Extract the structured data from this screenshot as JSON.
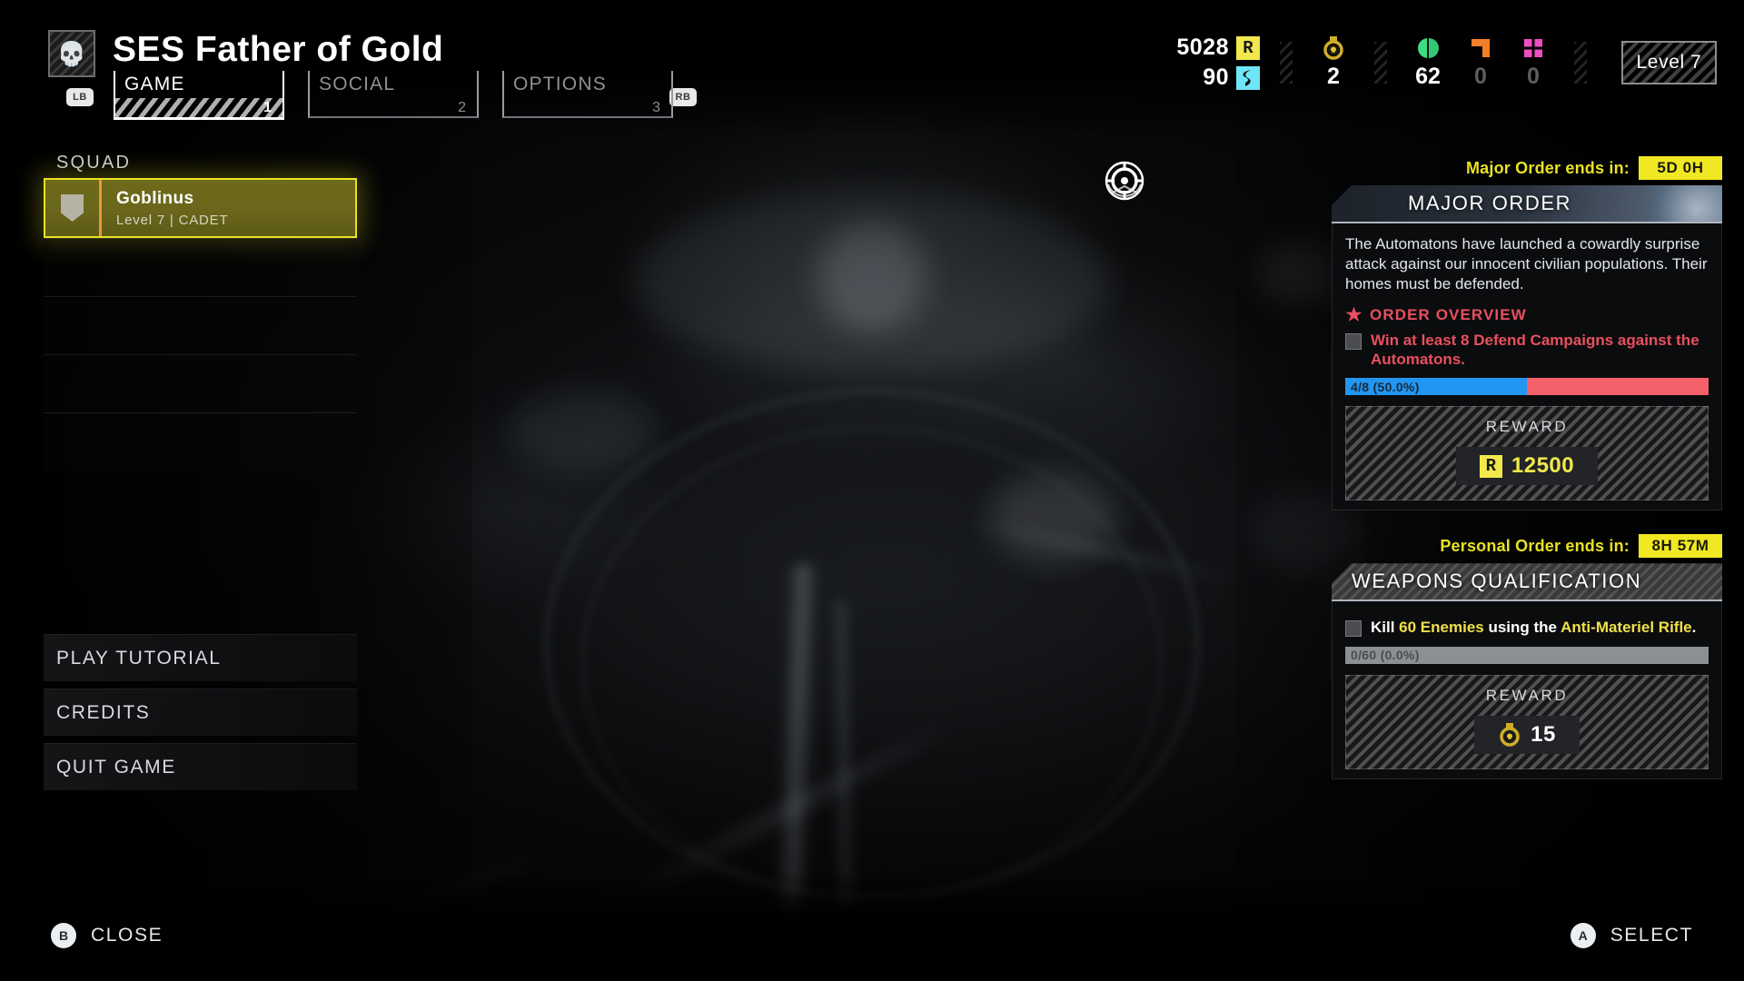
{
  "header": {
    "emblem_icon": "skull-icon",
    "ship_title": "SES Father of Gold",
    "lb_button": "LB",
    "rb_button": "RB",
    "tabs": [
      {
        "label": "GAME",
        "number": "1",
        "active": true
      },
      {
        "label": "SOCIAL",
        "number": "2",
        "active": false
      },
      {
        "label": "OPTIONS",
        "number": "3",
        "active": false
      }
    ]
  },
  "resources": {
    "requisition": {
      "value": "5028",
      "icon": "requisition-slip-icon",
      "glyph": "R",
      "color": "#f0e84c"
    },
    "samples_super": {
      "value": "90",
      "icon": "super-sample-icon",
      "glyph": "S",
      "color": "#6fe6f5"
    },
    "medals": {
      "value": "2",
      "icon": "medal-icon"
    },
    "samples_common": {
      "value": "62",
      "icon": "common-sample-icon",
      "color": "#3ddc84"
    },
    "samples_rare": {
      "value": "0",
      "icon": "rare-sample-icon",
      "color": "#f2802a"
    },
    "samples_pink": {
      "value": "0",
      "icon": "pink-sample-icon",
      "color": "#ee4fc0"
    },
    "level_badge": "Level 7"
  },
  "squad": {
    "section_label": "SQUAD",
    "members": [
      {
        "name": "Goblinus",
        "meta": "Level 7 | CADET",
        "avatar_icon": "shield-icon",
        "filled": true
      },
      {
        "filled": false
      },
      {
        "filled": false
      },
      {
        "filled": false
      },
      {
        "filled": false
      }
    ]
  },
  "menu": {
    "items": [
      {
        "label": "PLAY TUTORIAL"
      },
      {
        "label": "CREDITS"
      },
      {
        "label": "QUIT GAME"
      }
    ]
  },
  "major_order": {
    "timer_label": "Major Order ends in:",
    "timer_value": "5D 0H",
    "title": "MAJOR ORDER",
    "title_icon": "target-reticle-icon",
    "description": "The Automatons have launched a cowardly surprise attack against our innocent civilian populations. Their homes must be defended.",
    "overview_label": "ORDER OVERVIEW",
    "overview_icon": "star-icon",
    "task": "Win at least 8 Defend Campaigns against the Automatons.",
    "progress_text": "4/8 (50.0%)",
    "progress_percent": 50,
    "progress_fill_color": "#2196f3",
    "progress_track_color": "#f4616a",
    "reward_label": "REWARD",
    "reward_value": "12500",
    "reward_icon": "requisition-slip-icon",
    "reward_glyph": "R"
  },
  "personal_order": {
    "timer_label": "Personal Order ends in:",
    "timer_value": "8H 57M",
    "title": "WEAPONS QUALIFICATION",
    "task_prefix": "Kill ",
    "task_count": "60 Enemies",
    "task_mid": " using the ",
    "task_weapon": "Anti-Materiel Rifle",
    "task_suffix": ".",
    "progress_text": "0/60 (0.0%)",
    "progress_percent": 0,
    "reward_label": "REWARD",
    "reward_value": "15",
    "reward_icon": "medal-icon"
  },
  "footer": {
    "close_button": {
      "pad": "B",
      "label": "CLOSE"
    },
    "select_button": {
      "pad": "A",
      "label": "SELECT"
    }
  }
}
